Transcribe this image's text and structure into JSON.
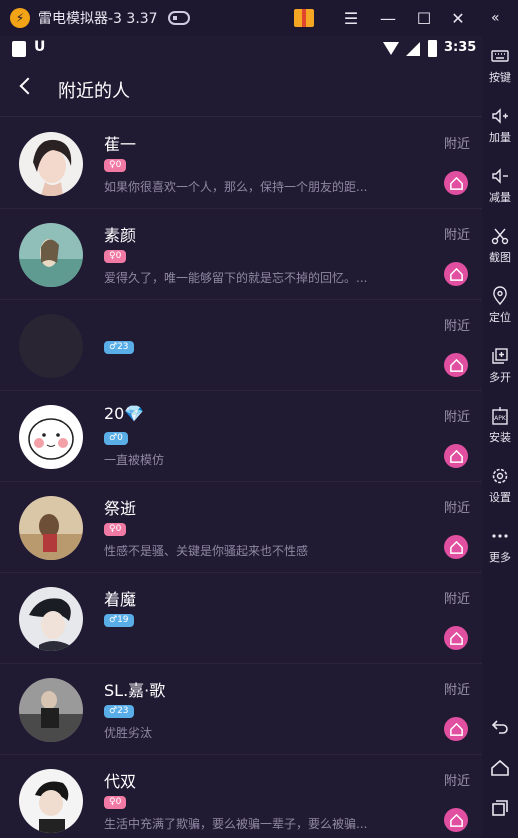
{
  "titlebar": {
    "title": "雷电模拟器-3 3.37"
  },
  "statusbar": {
    "time": "3:35"
  },
  "header": {
    "title": "附近的人"
  },
  "distance_label": "附近",
  "users": [
    {
      "name": "萑一",
      "gender": "female",
      "badge": "♀0",
      "bio": "如果你很喜欢一个人，那么，保持一个朋友的距..."
    },
    {
      "name": "素颜",
      "gender": "female",
      "badge": "♀0",
      "bio": "爱得久了，唯一能够留下的就是忘不掉的回忆。..."
    },
    {
      "name": "",
      "gender": "male",
      "badge": "♂23",
      "bio": ""
    },
    {
      "name": "20💎",
      "gender": "male",
      "badge": "♂0",
      "bio": "一直被模仿"
    },
    {
      "name": "祭逝",
      "gender": "female",
      "badge": "♀0",
      "bio": "性感不是骚、关键是你骚起来也不性感"
    },
    {
      "name": "着魔",
      "gender": "male",
      "badge": "♂19",
      "bio": ""
    },
    {
      "name": "SL.嘉·歌",
      "gender": "male",
      "badge": "♂23",
      "bio": "优胜劣汰"
    },
    {
      "name": "代双",
      "gender": "female",
      "badge": "♀0",
      "bio": "生活中充满了欺骗，要么被骗一辈子，要么被骗..."
    }
  ],
  "sidebar": {
    "items": [
      {
        "label": "按键",
        "icon": "keyboard-icon"
      },
      {
        "label": "加量",
        "icon": "volume-up-icon"
      },
      {
        "label": "减量",
        "icon": "volume-down-icon"
      },
      {
        "label": "截图",
        "icon": "scissors-icon"
      },
      {
        "label": "定位",
        "icon": "location-pin-icon"
      },
      {
        "label": "多开",
        "icon": "multi-open-icon"
      },
      {
        "label": "安装",
        "icon": "apk-install-icon"
      },
      {
        "label": "设置",
        "icon": "gear-icon"
      },
      {
        "label": "更多",
        "icon": "more-icon"
      }
    ]
  },
  "colors": {
    "background": "#211a33",
    "female_badge": "#f17aa4",
    "male_badge": "#5aaee8",
    "home_button": "#e04fa0"
  }
}
